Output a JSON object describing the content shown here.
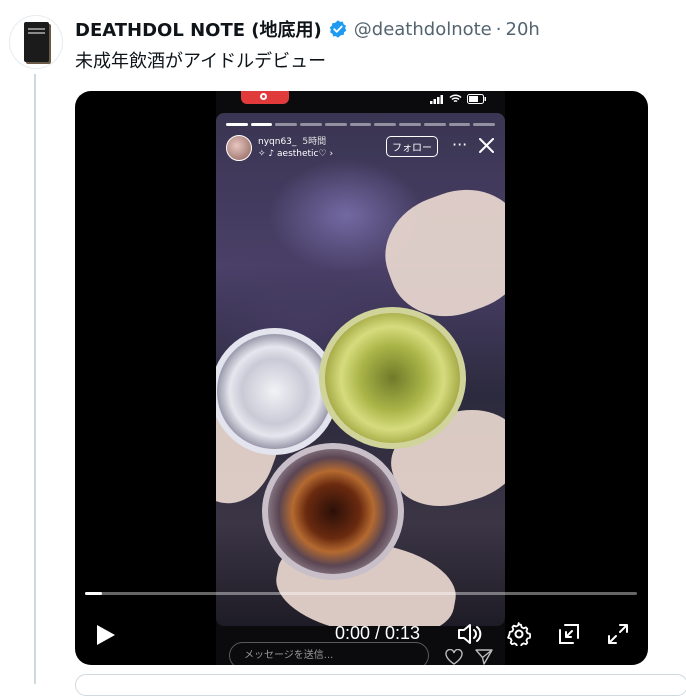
{
  "tweet": {
    "display_name": "DEATHDOL NOTE (地底用)",
    "handle": "@deathdolnote",
    "separator": "·",
    "time": "20h",
    "text": "未成年飲酒がアイドルデビュー",
    "verified_color": "#1d9bf0"
  },
  "story": {
    "username": "nyqn63_",
    "age": "5時間",
    "music": "aesthetic♡",
    "follow_label": "フォロー",
    "message_placeholder": "メッセージを送信...",
    "progress_segments_total": 11,
    "progress_segments_done": 2
  },
  "player": {
    "time": "0:00 / 0:13",
    "progress_fraction": 0.03
  },
  "icons": {
    "verified": "verified-badge-icon",
    "play": "play-icon",
    "volume": "volume-icon",
    "settings": "gear-icon",
    "pip": "picture-in-picture-icon",
    "fullscreen": "fullscreen-icon"
  }
}
